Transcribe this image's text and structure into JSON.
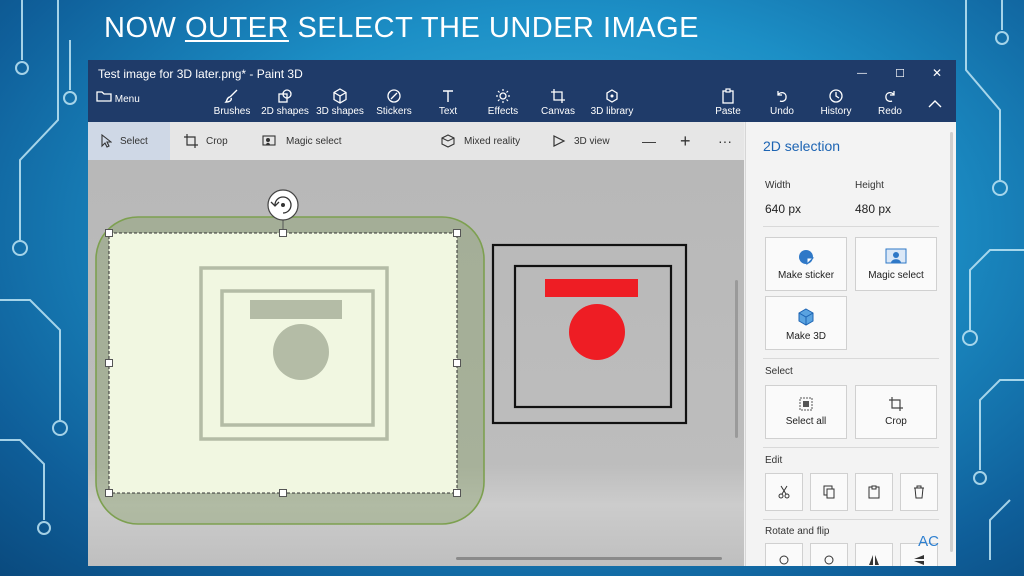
{
  "slide": {
    "title_prefix": "NOW",
    "title_emphasis": "OUTER",
    "title_suffix": "SELECT THE UNDER IMAGE"
  },
  "window": {
    "title": "Test image for 3D later.png* - Paint 3D",
    "controls": {
      "minimize": "—",
      "maximize": "☐",
      "close": "✕"
    }
  },
  "toolbar": {
    "menu": "Menu",
    "items": [
      "Brushes",
      "2D shapes",
      "3D shapes",
      "Stickers",
      "Text",
      "Effects",
      "Canvas",
      "3D library"
    ],
    "right_items": [
      "Paste",
      "Undo",
      "History",
      "Redo"
    ]
  },
  "subbar": {
    "select": "Select",
    "crop": "Crop",
    "magic_select": "Magic select",
    "mixed_reality": "Mixed reality",
    "view_3d": "3D view",
    "zoom_out": "—",
    "zoom_in": "+",
    "more": "···"
  },
  "panel": {
    "title": "2D selection",
    "width_label": "Width",
    "width_value": "640 px",
    "height_label": "Height",
    "height_value": "480 px",
    "make_sticker": "Make sticker",
    "magic_select": "Magic select",
    "make_3d": "Make 3D",
    "select_heading": "Select",
    "select_all": "Select all",
    "crop": "Crop",
    "edit_heading": "Edit",
    "rotate_heading": "Rotate and flip",
    "watermark": "AC"
  },
  "colors": {
    "app_bar": "#1f3b69",
    "accent": "#1d64b3",
    "selection_fill": "#f1f7e1",
    "selection_outline": "#7da050",
    "red": "#ee1d24"
  }
}
